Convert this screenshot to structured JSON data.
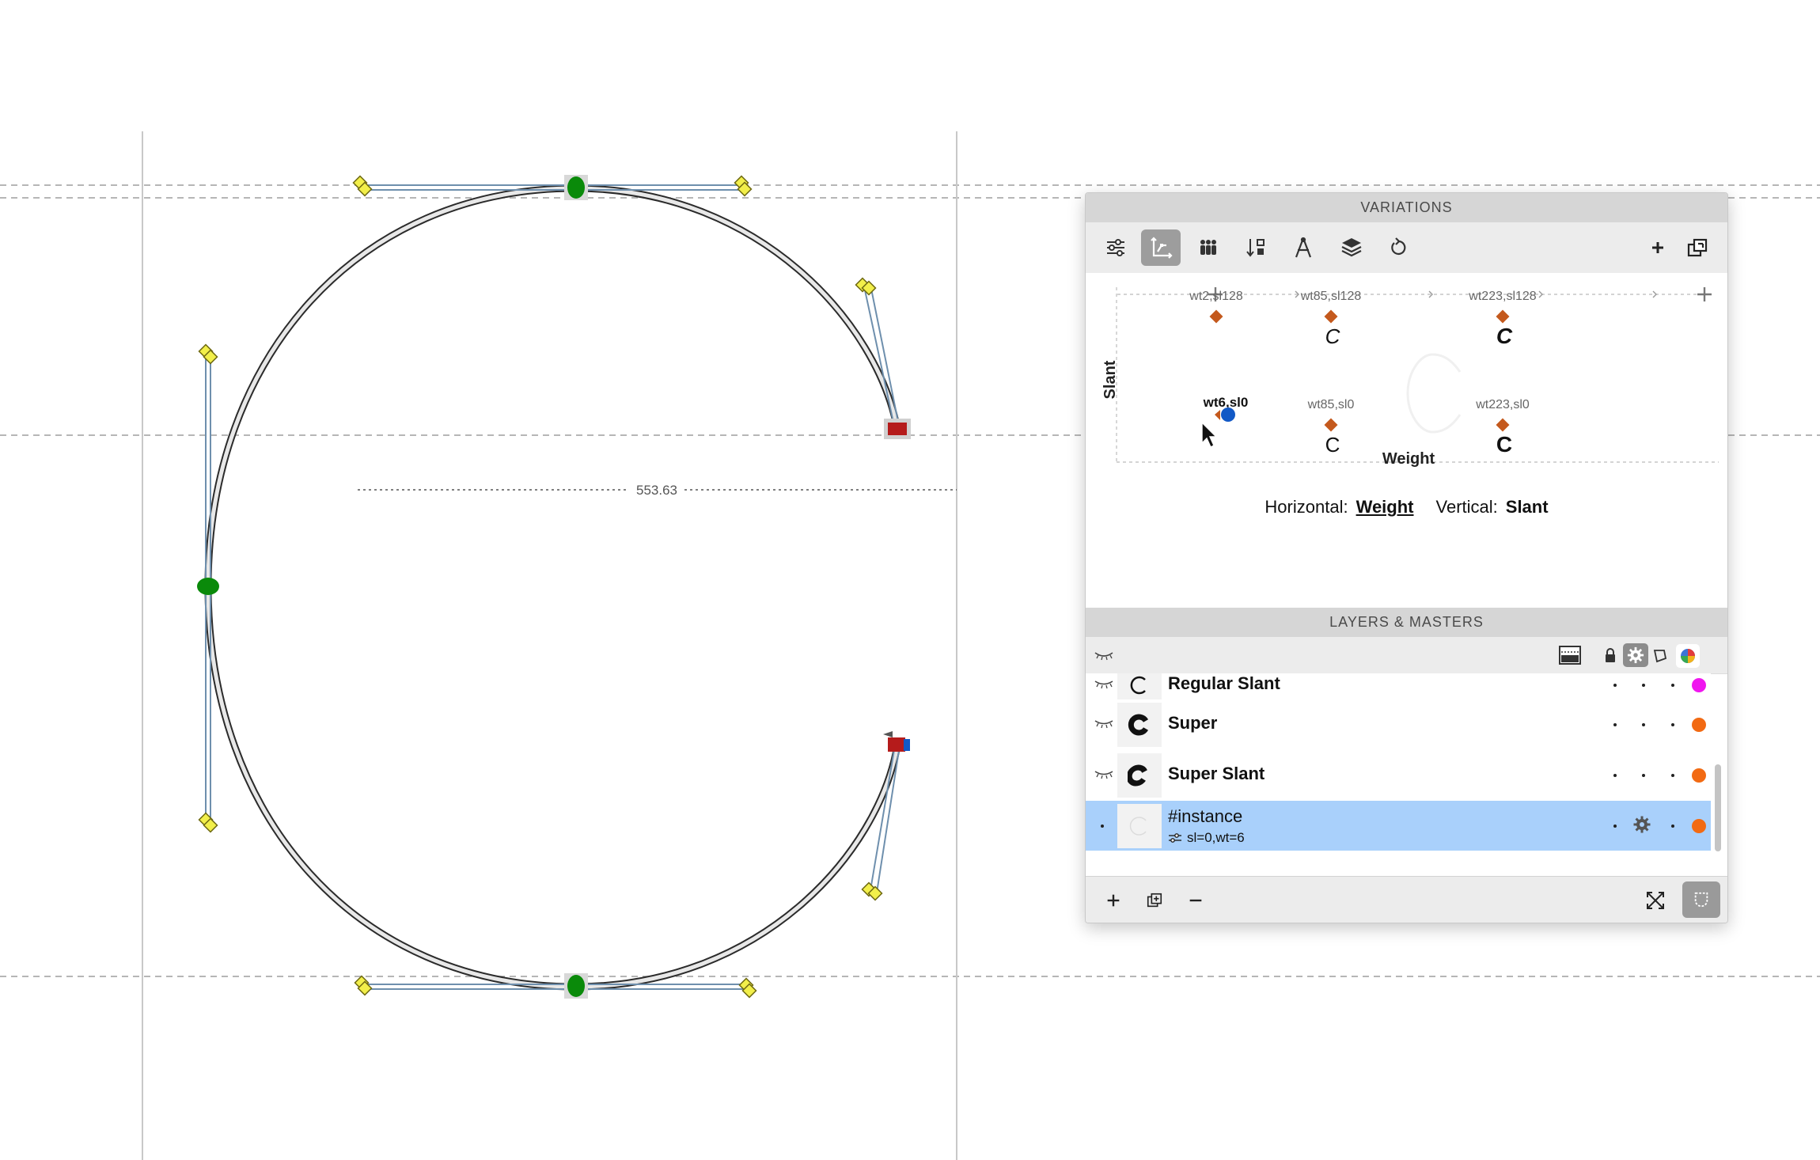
{
  "canvas": {
    "measurement_label": "553.63"
  },
  "variations": {
    "header": "VARIATIONS",
    "toolbar": [
      "sliders-icon",
      "axes-graph-icon",
      "people-icon",
      "sort-icon",
      "compass-icon",
      "layers-icon",
      "refresh-icon",
      "add-icon",
      "window-detach-icon"
    ],
    "active_tool": "axes-graph-icon",
    "x_axis_label": "Weight",
    "y_axis_label": "Slant",
    "masters": [
      {
        "label": "wt2,sl128",
        "glyph": ""
      },
      {
        "label": "wt85,sl128",
        "glyph": "C"
      },
      {
        "label": "wt223,sl128",
        "glyph": "C"
      },
      {
        "label": "wt85,sl0",
        "glyph": "C"
      },
      {
        "label": "wt223,sl0",
        "glyph": "C"
      }
    ],
    "current_instance_label": "wt6,sl0",
    "horizontal_key": "Horizontal:",
    "horizontal_value": "Weight",
    "vertical_key": "Vertical:",
    "vertical_value": "Slant"
  },
  "layers": {
    "header": "LAYERS & MASTERS",
    "rows": [
      {
        "name": "Regular Slant",
        "color": "#f016ef"
      },
      {
        "name": "Super",
        "color": "#f26a13"
      },
      {
        "name": "Super Slant",
        "color": "#f26a13"
      },
      {
        "name": "#instance",
        "sub": "sl=0,wt=6",
        "color": "#f26a13",
        "selected": true
      }
    ]
  },
  "colors": {
    "on_curve": "#0a8a0a",
    "handle": "#f2ef4a",
    "corner_point": "#b51b1b",
    "master_diamond": "#c4591d",
    "instance_dot": "#1259c6",
    "selection": "#a9d0fb"
  }
}
